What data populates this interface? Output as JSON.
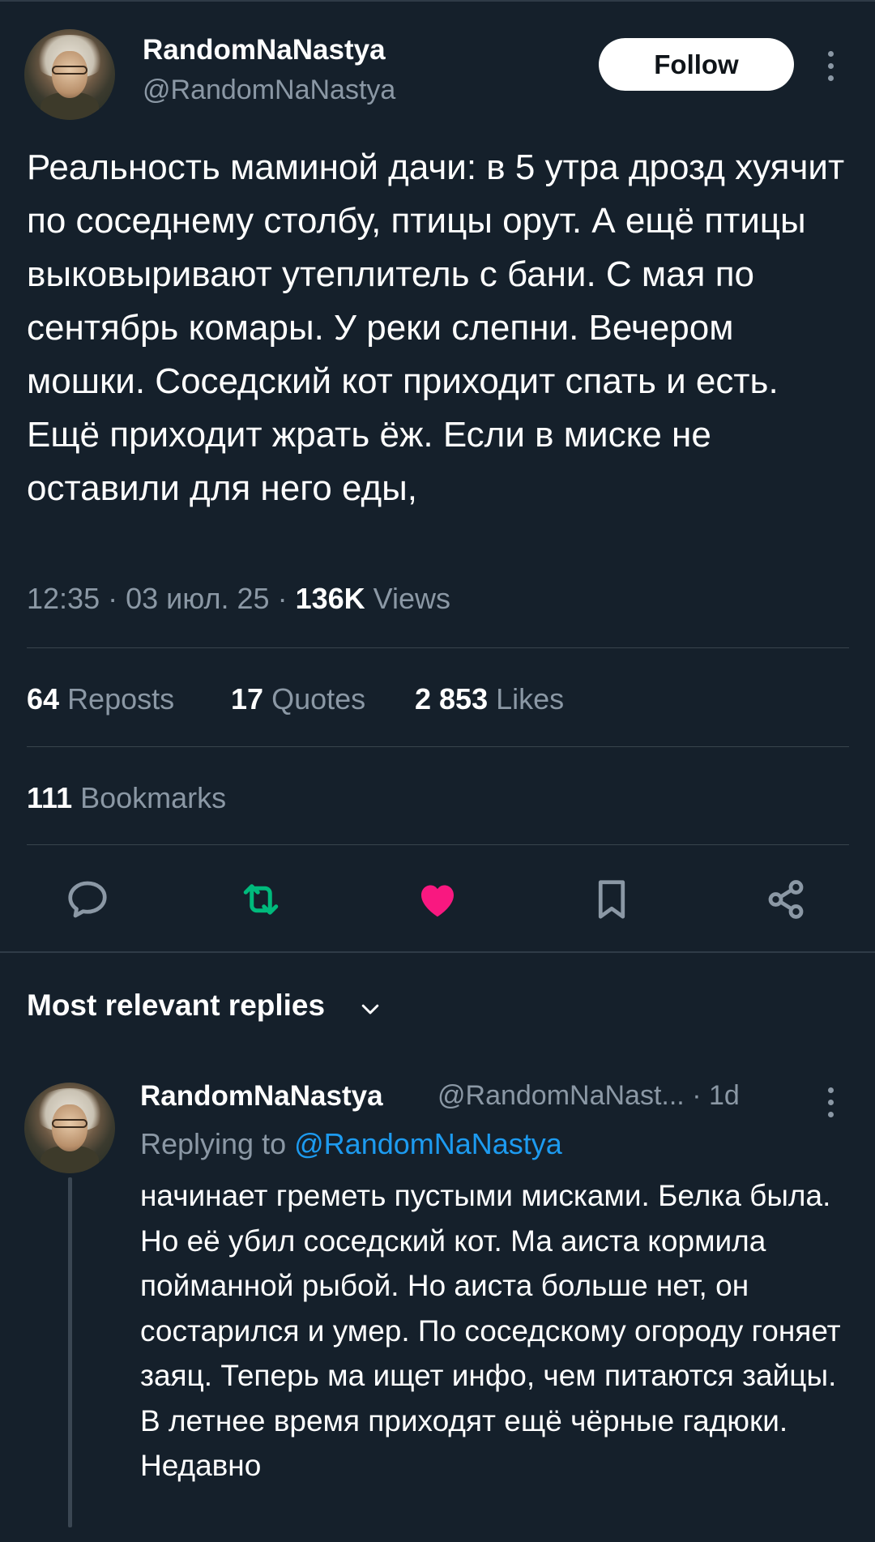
{
  "tweet": {
    "author": {
      "name": "RandomNaNastya",
      "handle": "@RandomNaNastya"
    },
    "follow_label": "Follow",
    "text": "Реальность маминой дачи: в 5 утра дрозд хуячит по соседнему столбу, птицы орут. А ещё птицы выковыривают утеплитель с бани. С мая по сентябрь комары. У реки слепни. Вечером мошки. Соседский кот приходит спать и есть. Ещё приходит жрать ёж. Если в миске не оставили для него еды,",
    "time": "12:35",
    "date": "03 июл. 25",
    "views_count": "136K",
    "views_label": "Views",
    "separator": "·"
  },
  "stats": {
    "reposts": {
      "count": "64",
      "label": "Reposts"
    },
    "quotes": {
      "count": "17",
      "label": "Quotes"
    },
    "likes": {
      "count": "2 853",
      "label": "Likes"
    },
    "bookmarks": {
      "count": "111",
      "label": "Bookmarks"
    }
  },
  "actions": {
    "icons": [
      "reply-icon",
      "repost-icon",
      "like-icon",
      "bookmark-icon",
      "share-icon"
    ],
    "colors": {
      "reply": "#8b98a5",
      "repost": "#00ba7c",
      "like": "#f91880",
      "bookmark": "#8b98a5",
      "share": "#8b98a5"
    }
  },
  "replies": {
    "header_label": "Most relevant replies",
    "items": [
      {
        "name": "RandomNaNastya",
        "handle": "@RandomNaNast...",
        "separator": "·",
        "age": "1d",
        "replying_prefix": "Replying to",
        "replying_mention": "@RandomNaNastya",
        "text_line_1": "начинает греметь пустыми мисками. Белка была. Но её убил соседский кот. Ма аиста кормила пойманной рыбой. Но аиста больше нет, он состарился и умер. По соседскому огороду гоняет заяц. Теперь ма ищет инфо, чем питаются зайцы.",
        "text_line_2": "В летнее время приходят ещё чёрные гадюки. Недавно"
      }
    ]
  },
  "colors": {
    "background": "#15202b",
    "text": "#ffffff",
    "secondary": "#8b98a5",
    "link": "#1d9bf0",
    "divider": "#38444d"
  }
}
